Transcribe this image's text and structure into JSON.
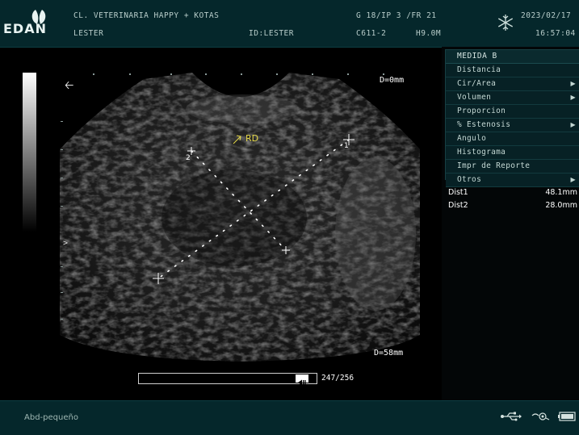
{
  "header": {
    "brand": "EDAN",
    "clinic": "CL. VETERINARIA HAPPY + KOTAS",
    "patient": "LESTER",
    "patient_id": "ID:LESTER",
    "imaging_params": "G 18/IP 3 /FR 21",
    "probe": "C611-2",
    "frequency": "H9.0M",
    "date": "2023/02/17",
    "time": "16:57:04"
  },
  "image": {
    "depth_top": "D=0mm",
    "depth_bottom": "D=58mm",
    "annotation": "RD",
    "caliper_1": "1",
    "caliper_2": "2",
    "cine_count": "247/256",
    "cine_position": 0.965
  },
  "menu": {
    "title": "MEDIDA B",
    "items": [
      {
        "label": "Distancia",
        "submenu": false
      },
      {
        "label": "Cir/Area",
        "submenu": true
      },
      {
        "label": "Volumen",
        "submenu": true
      },
      {
        "label": "Proporcion",
        "submenu": false
      },
      {
        "label": "% Estenosis",
        "submenu": true
      },
      {
        "label": "Angulo",
        "submenu": false
      },
      {
        "label": "Histograma",
        "submenu": false
      },
      {
        "label": "Impr de Reporte",
        "submenu": false
      },
      {
        "label": "Otros",
        "submenu": true
      }
    ]
  },
  "results": [
    {
      "label": "Dist1",
      "value": "48.1mm"
    },
    {
      "label": "Dist2",
      "value": "28.0mm"
    }
  ],
  "footer": {
    "preset": "Abd-pequeño",
    "icons": [
      "usb-icon",
      "probe-icon",
      "battery-icon"
    ]
  },
  "colors": {
    "bar_bg": "#05272b",
    "annotation": "#e6d94a",
    "menu_bg": "#072125"
  }
}
